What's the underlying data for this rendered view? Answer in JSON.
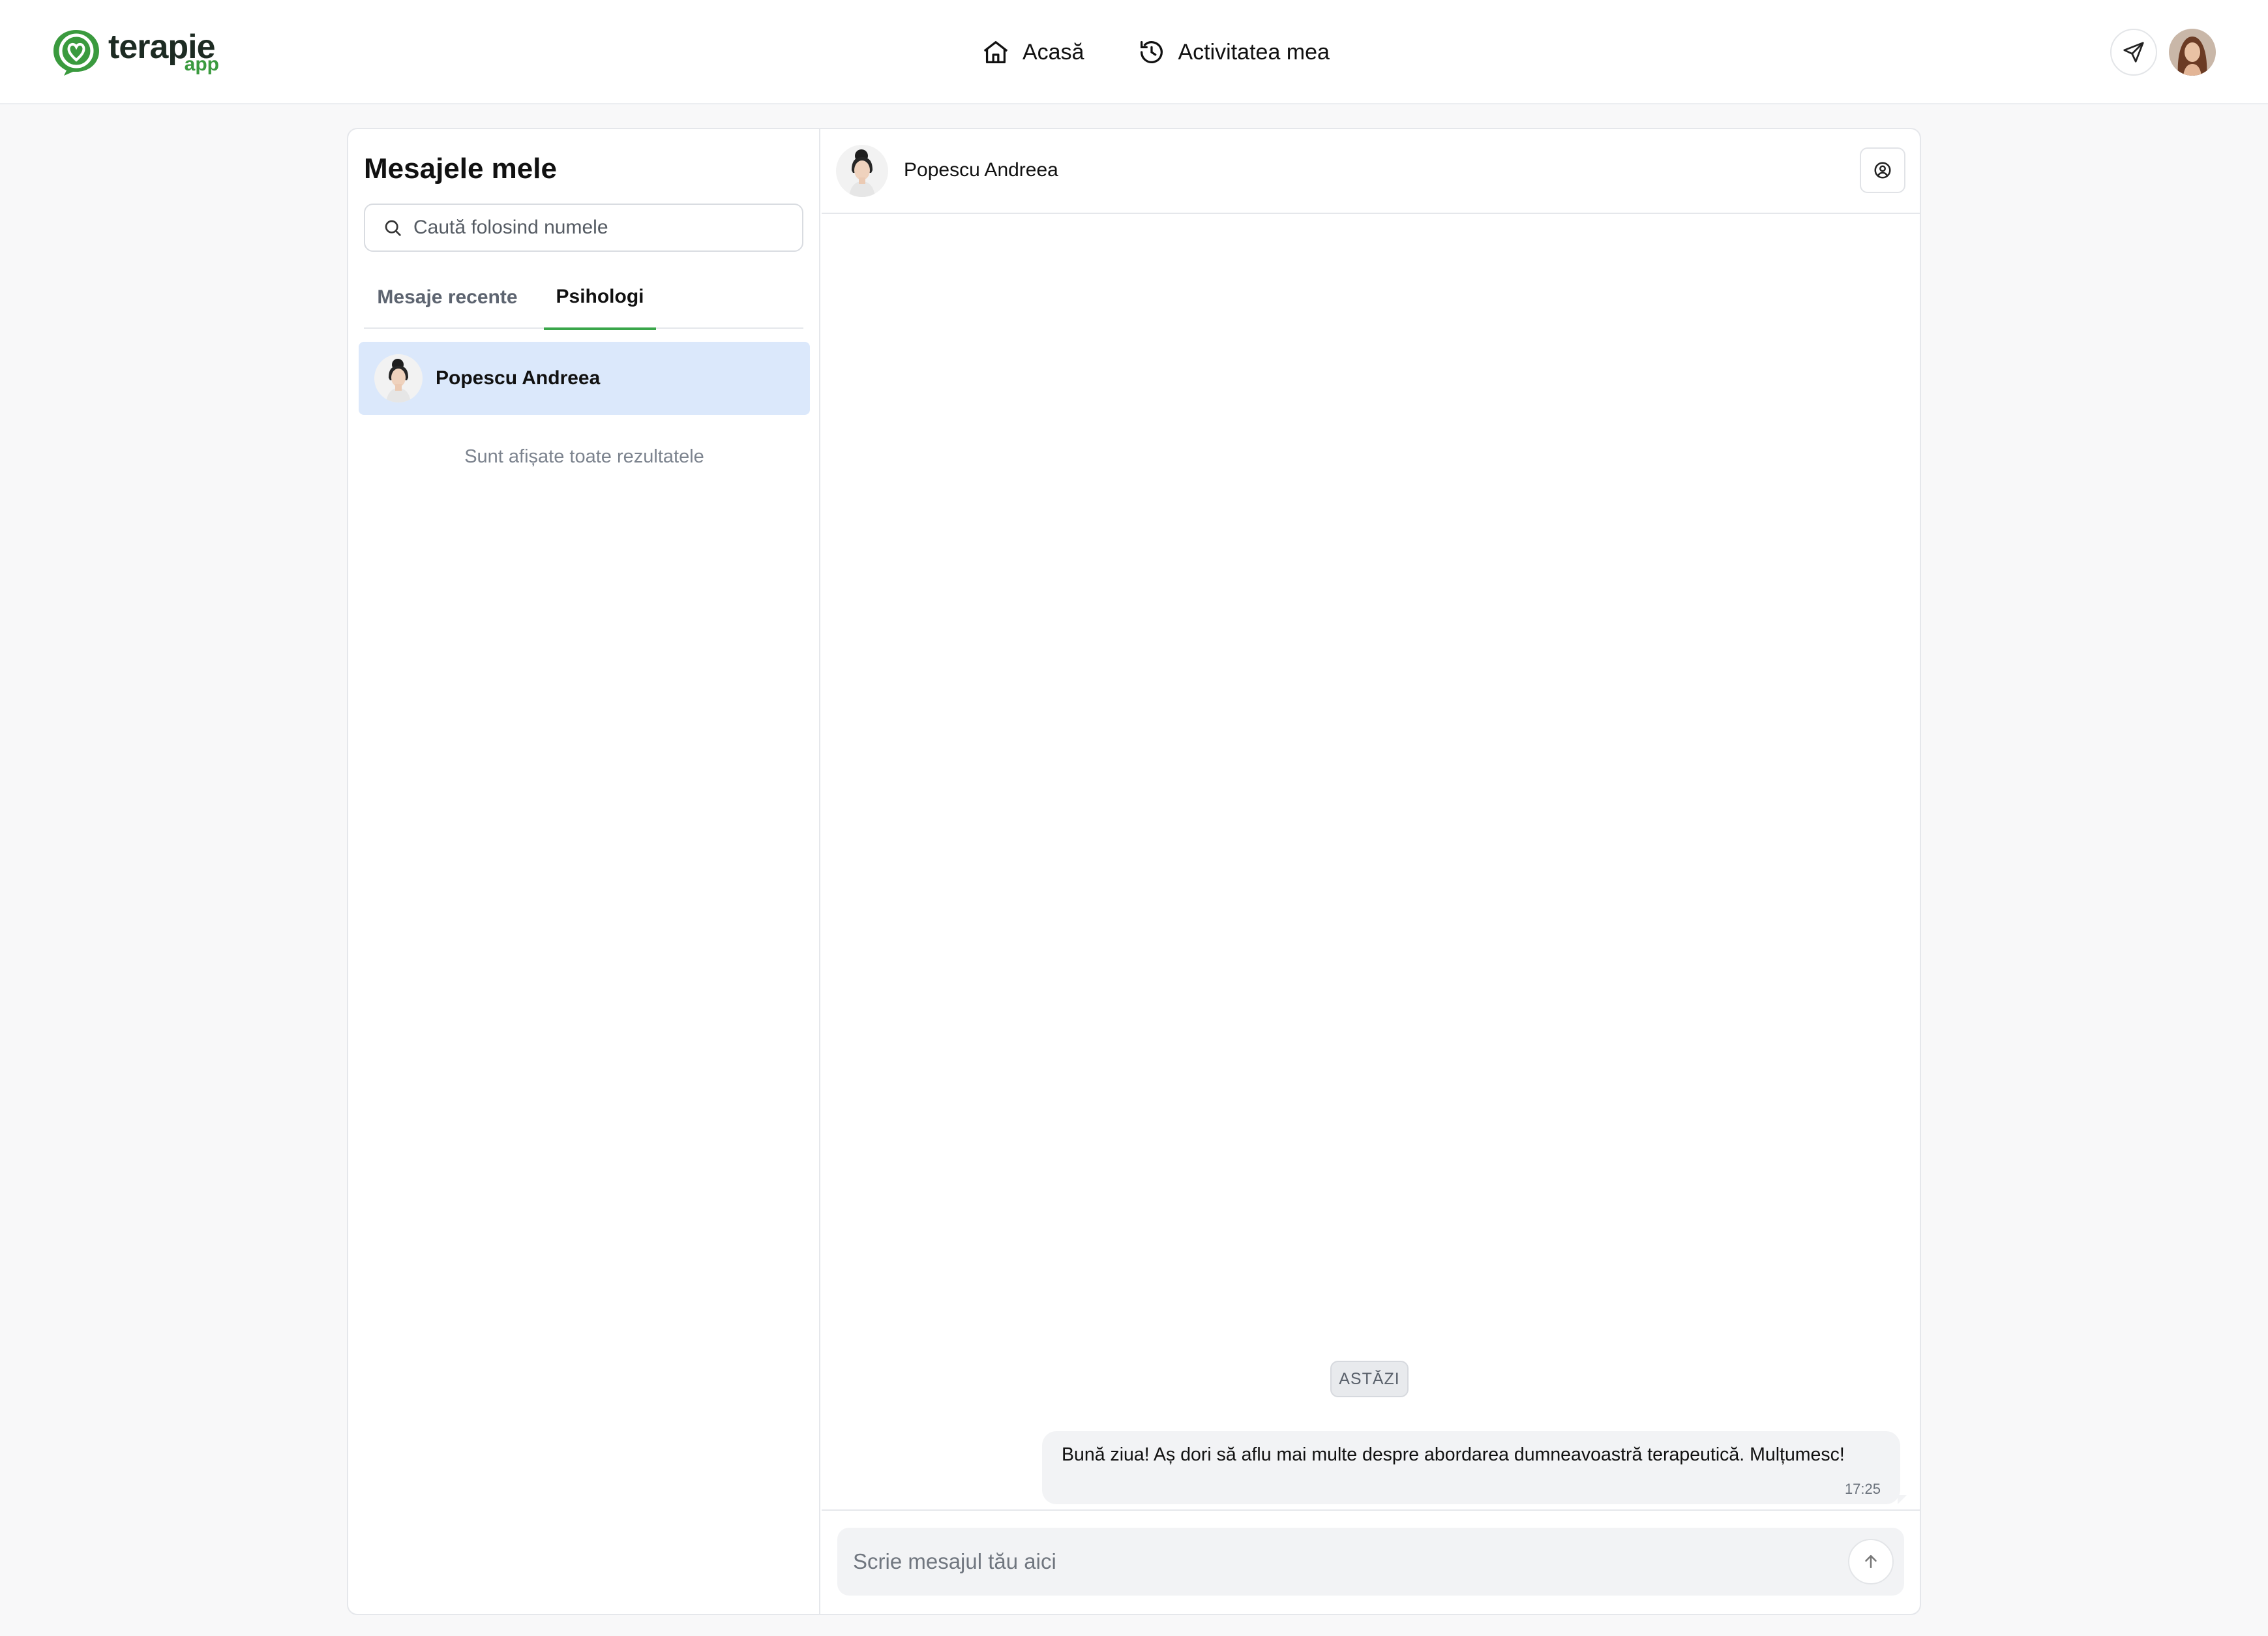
{
  "brand": {
    "name": "terapie",
    "sub": "app",
    "accent": "#3aa64a"
  },
  "nav": {
    "links": [
      {
        "label": "Acasă",
        "icon": "home-icon"
      },
      {
        "label": "Activitatea mea",
        "icon": "history-icon"
      }
    ],
    "send_icon": "send-icon"
  },
  "sidebar": {
    "title": "Mesajele mele",
    "search": {
      "placeholder": "Caută folosind numele",
      "value": ""
    },
    "tabs": [
      {
        "label": "Mesaje recente",
        "active": false
      },
      {
        "label": "Psihologi",
        "active": true
      }
    ],
    "contacts": [
      {
        "name": "Popescu Andreea",
        "selected": true
      }
    ],
    "footer_note": "Sunt afișate toate rezultatele"
  },
  "chat": {
    "contact_name": "Popescu Andreea",
    "date_separator": "ASTĂZI",
    "messages": [
      {
        "text": "Bună ziua! Aș dori să aflu mai multe despre abordarea dumneavoastră terapeutică. Mulțumesc!",
        "time": "17:25",
        "outgoing": true
      }
    ],
    "composer": {
      "placeholder": "Scrie mesajul tău aici",
      "value": ""
    }
  }
}
